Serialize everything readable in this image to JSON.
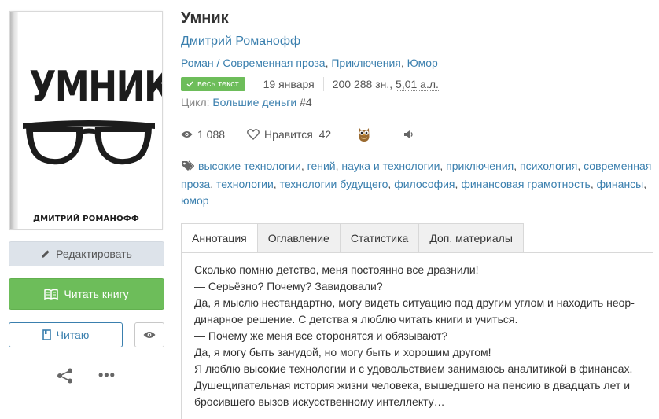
{
  "cover": {
    "title": "УМНИК",
    "author": "ДМИТРИЙ РОМАНОФФ",
    "icon": "glasses-illustration"
  },
  "actions": {
    "edit_label": "Редактировать",
    "read_label": "Читать книгу",
    "reading_label": "Читаю",
    "eye_icon": "eye-icon",
    "share_icon": "share-icon",
    "more_label": "•••"
  },
  "book": {
    "title": "Умник",
    "author": "Дмитрий Романофф",
    "genres": [
      {
        "label": "Роман / Современная проза",
        "sep": ", "
      },
      {
        "label": "Приключения",
        "sep": ", "
      },
      {
        "label": "Юмор",
        "sep": ""
      }
    ],
    "status_badge": "весь текст",
    "date": "19 января",
    "size_chars": "200 288 зн.,",
    "size_al": "5,01 а.л.",
    "cycle_label": "Цикл:",
    "cycle_name": "Большие деньги",
    "cycle_num": "#4"
  },
  "stats": {
    "views": "1 088",
    "likes_label": "Нравится",
    "likes": "42"
  },
  "tags": [
    "высокие технологии",
    "гений",
    "наука и технологии",
    "приключения",
    "психология",
    "современная проза",
    "технологии",
    "технологии будущего",
    "философия",
    "финансовая грамотность",
    "финансы",
    "юмор"
  ],
  "tabs": [
    {
      "label": "Аннотация",
      "active": true
    },
    {
      "label": "Оглавление",
      "active": false
    },
    {
      "label": "Статистика",
      "active": false
    },
    {
      "label": "Доп. материалы",
      "active": false
    }
  ],
  "annotation": [
    "Сколько помню детство, меня постоянно все дразнили!",
    "— Серьёзно? Почему? Завидовали?",
    "Да, я мыслю нестандартно, могу видеть ситуацию под другим углом и находить неор-",
    "динарное решение. С детства я люблю читать книги и учиться.",
    "— Почему же меня все сторонятся и обязывают?",
    "Да, я могу быть занудой, но могу быть и хорошим другом!",
    "Я люблю высокие технологии и с удовольствием занимаюсь аналитикой в финансах.",
    "Душещипательная история жизни человека, вышедшего на пенсию в двадцать лет и",
    "бросившего вызов искусственному интеллекту…"
  ],
  "colors": {
    "link": "#3a7fae",
    "green": "#6dbd5a",
    "edit_bg": "#dde3ea"
  }
}
